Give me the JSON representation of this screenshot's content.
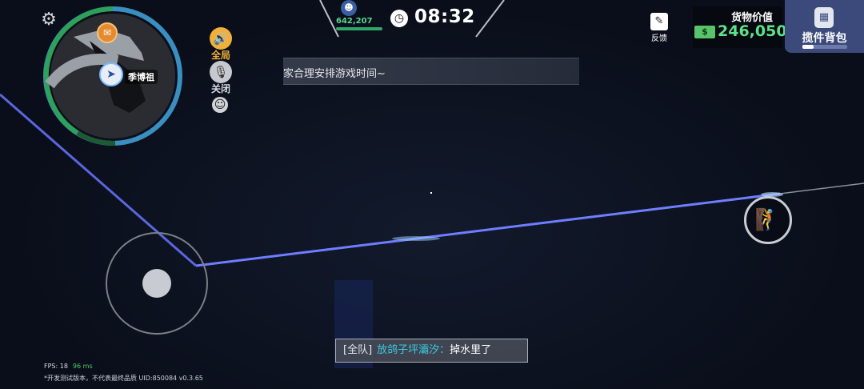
{
  "minimap": {
    "player_label": "季博祖"
  },
  "voice": {
    "speaker_label": "全局",
    "mic_label": "关闭"
  },
  "player": {
    "money": "642,207"
  },
  "timer": {
    "value": "08:32"
  },
  "banner": {
    "text": "家合理安排游戏时间~"
  },
  "feedback": {
    "label": "反馈"
  },
  "cargo": {
    "title": "货物价值",
    "value": "246,050"
  },
  "backpack": {
    "label": "揽件背包",
    "fill_fraction": 0.25
  },
  "chat": {
    "channel": "[全队]",
    "sender": "放鸽子坪灞汐：",
    "message": "掉水里了"
  },
  "stats": {
    "fps": "FPS: 18",
    "ping": "96 ms"
  },
  "footer": {
    "text": "*开发测试版本，不代表最终品质   UID:850084   v0.3.65"
  },
  "colors": {
    "laser": "#6f7dff",
    "money_green": "#5fe08a",
    "backpack_bg": "#3b4a7a",
    "chat_name": "#39c9e0"
  },
  "icons": [
    "gear-icon",
    "speaker-icon",
    "mic-off-icon",
    "smile-icon",
    "clock-icon",
    "feedback-icon",
    "cash-icon",
    "backpack-icon",
    "climb-icon"
  ]
}
